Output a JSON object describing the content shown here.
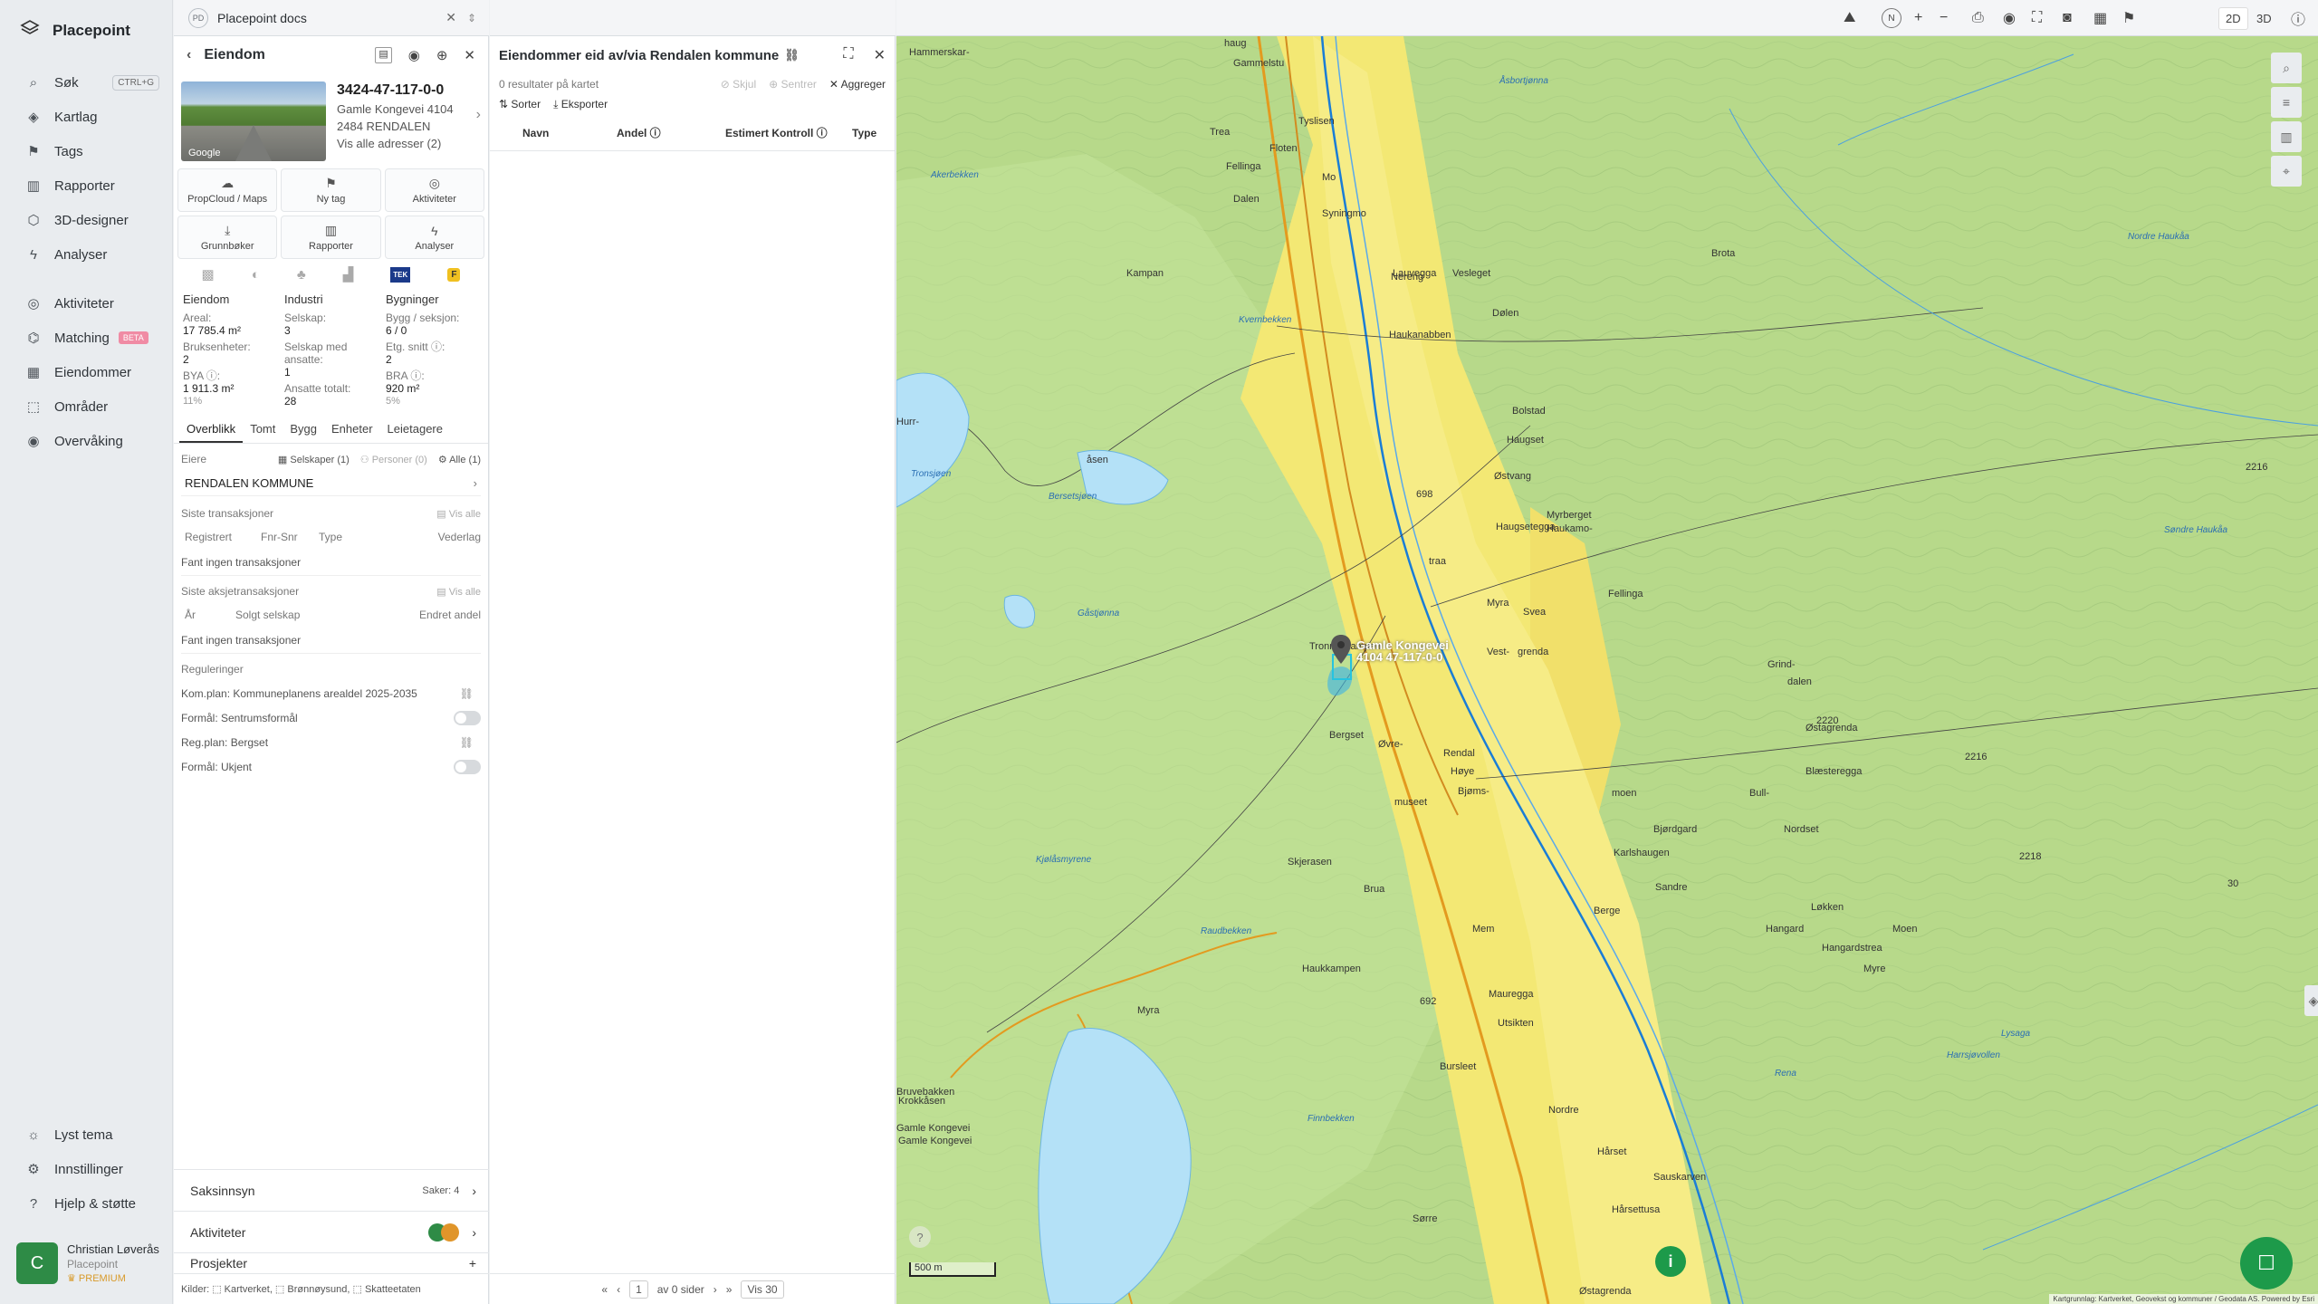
{
  "app": {
    "name": "Placepoint"
  },
  "nav": {
    "items": [
      {
        "label": "Søk",
        "icon": "search-icon",
        "glyph": "⌕",
        "kbd": "CTRL+G"
      },
      {
        "label": "Kartlag",
        "icon": "layers-icon",
        "glyph": "◈"
      },
      {
        "label": "Tags",
        "icon": "bookmark-icon",
        "glyph": "⚑"
      },
      {
        "label": "Rapporter",
        "icon": "bar-chart-icon",
        "glyph": "▥"
      },
      {
        "label": "3D-designer",
        "icon": "cube-icon",
        "glyph": "⬡"
      },
      {
        "label": "Analyser",
        "icon": "bolt-icon",
        "glyph": "ϟ"
      },
      {
        "label": "Aktiviteter",
        "icon": "chat-icon",
        "glyph": "◎"
      },
      {
        "label": "Matching",
        "icon": "match-icon",
        "glyph": "⌬",
        "badge": "BETA"
      },
      {
        "label": "Eiendommer",
        "icon": "building-icon",
        "glyph": "▦"
      },
      {
        "label": "Områder",
        "icon": "area-icon",
        "glyph": "⬚"
      },
      {
        "label": "Overvåking",
        "icon": "eye-icon",
        "glyph": "◉"
      }
    ],
    "bottom": [
      {
        "label": "Lyst tema",
        "icon": "sun-icon",
        "glyph": "☼"
      },
      {
        "label": "Innstillinger",
        "icon": "gear-icon",
        "glyph": "⚙"
      },
      {
        "label": "Hjelp & støtte",
        "icon": "help-icon",
        "glyph": "?"
      }
    ],
    "user": {
      "initial": "C",
      "name": "Christian Løverås",
      "org": "Placepoint",
      "plan": "PREMIUM"
    }
  },
  "tab": {
    "badge": "PD",
    "title": "Placepoint docs"
  },
  "property": {
    "header": "Eiendom",
    "id": "3424-47-117-0-0",
    "address": "Gamle Kongevei 4104",
    "postal": "2484 RENDALEN",
    "all_addresses": "Vis alle adresser (2)",
    "photo_credit": "Google",
    "actions": [
      "PropCloud / Maps",
      "Ny tag",
      "Aktiviteter",
      "Grunnbøker",
      "Rapporter",
      "Analyser"
    ],
    "stats": {
      "col1": {
        "title": "Eiendom",
        "areal_l": "Areal:",
        "areal_v": "17 785.4 m²",
        "bruk_l": "Bruksenheter:",
        "bruk_v": "2",
        "bya_l": "BYA ⓘ:",
        "bya_v": "1 911.3 m²",
        "bya_p": "11%"
      },
      "col2": {
        "title": "Industri",
        "sel_l": "Selskap:",
        "sel_v": "3",
        "sma_l": "Selskap med ansatte:",
        "sma_v": "1",
        "ans_l": "Ansatte totalt:",
        "ans_v": "28"
      },
      "col3": {
        "title": "Bygninger",
        "bygg_l": "Bygg / seksjon:",
        "bygg_v": "6 / 0",
        "etg_l": "Etg. snitt ⓘ:",
        "etg_v": "2",
        "bra_l": "BRA ⓘ:",
        "bra_v": "920 m²",
        "bra_p": "5%"
      }
    },
    "tabs": [
      "Overblikk",
      "Tomt",
      "Bygg",
      "Enheter",
      "Leietagere"
    ],
    "owners": {
      "label": "Eiere",
      "f1": "Selskaper (1)",
      "f2": "Personer (0)",
      "f3": "Alle (1)",
      "owner": "RENDALEN KOMMUNE"
    },
    "tx": {
      "title": "Siste transaksjoner",
      "show": "Vis alle",
      "cols": [
        "Registrert",
        "Fnr-Snr",
        "Type",
        "Vederlag"
      ],
      "empty": "Fant ingen transaksjoner"
    },
    "stx": {
      "title": "Siste aksjetransaksjoner",
      "show": "Vis alle",
      "cols": [
        "År",
        "Solgt selskap",
        "Endret andel"
      ],
      "empty": "Fant ingen transaksjoner"
    },
    "reg": {
      "title": "Reguleringer",
      "items": [
        "Kom.plan: Kommuneplanens arealdel 2025-2035",
        "Formål: Sentrumsformål",
        "Reg.plan: Bergset",
        "Formål: Ukjent"
      ]
    },
    "acc": [
      {
        "label": "Saksinnsyn",
        "extra": "Saker: 4"
      },
      {
        "label": "Aktiviteter",
        "extra": ""
      },
      {
        "label": "Prosjekter",
        "extra": "+"
      }
    ],
    "sources": "Kilder: ⬚ Kartverket, ⬚ Brønnøysund, ⬚ Skatteetaten"
  },
  "list": {
    "title": "Eiendommer eid av/via Rendalen kommune",
    "results": "0 resultater på kartet",
    "hide": "Skjul",
    "center": "Sentrer",
    "aggregate": "Aggreger",
    "sort": "Sorter",
    "export": "Eksporter",
    "cols": [
      "Navn",
      "Andel ⓘ",
      "Estimert Kontroll ⓘ",
      "Type"
    ],
    "pager": {
      "page": "1",
      "of": "av 0 sider",
      "per": "Vis 30"
    }
  },
  "map": {
    "mode2d": "2D",
    "mode3d": "3D",
    "compass": "N",
    "scale": "500 m",
    "pin_label": "Gamle Kongevei 4104 47-117-0-0",
    "attribution": "Kartgrunnlag: Kartverket, Geovekst og kommuner / Geodata AS. Powered by Esri",
    "places": [
      "Hammerskar-",
      "haug",
      "Gammelstu",
      "Tyslisen",
      "Trea",
      "Floten",
      "Fellinga",
      "Mo",
      "Dalen",
      "Syningmo",
      "Brota",
      "Kampan",
      "Lauvegga",
      "Nereng",
      "Vesleget",
      "Dølen",
      "Haukanabben",
      "Bolstad",
      "Haugset",
      "Østvang",
      "Haugsetegga",
      "Myrberget",
      "Haukamo-",
      "traa",
      "Fellinga",
      "Myra",
      "Svea",
      "Vest-",
      "Tronneskampen",
      "grenda",
      "Grind-",
      "dalen",
      "Bergset",
      "Øvre-",
      "Rendal",
      "Høye",
      "Østagrenda",
      "Blæsteregga",
      "Bjøms-",
      "moen",
      "Bull-",
      "museet",
      "Nordset",
      "Bjørdgard",
      "Karlshaugen",
      "Skjerasen",
      "Sandre",
      "Brua",
      "Berge",
      "Løkken",
      "Mem",
      "Hangard",
      "Moen",
      "Hangardstrea",
      "Myre",
      "Harrsjøvollen",
      "Myra",
      "Haukkampen",
      "Mauregga",
      "Utsikten",
      "Bursleet",
      "Nordre",
      "Hårset",
      "Sørre",
      "Sauskarven",
      "Hårsettusa",
      "Bruvebakken",
      "Krokkåsen",
      "Kjølåsmyrene",
      "Raudbekken",
      "Gåstjønna",
      "Bersetsjøen",
      "Tronsjøen",
      "Åsbortjønna",
      "Nordre Haukåa",
      "Søndre Haukåa",
      "Rena",
      "Lysaga",
      "Akerbekken",
      "Kvernbekken",
      "Finnbekken",
      "Gamle Kongevei",
      "Gamle Kongevei",
      "Østagrenda",
      "Hurr-",
      "åsen",
      "698",
      "692",
      "2220",
      "2216",
      "2218",
      "2216",
      "30"
    ]
  }
}
